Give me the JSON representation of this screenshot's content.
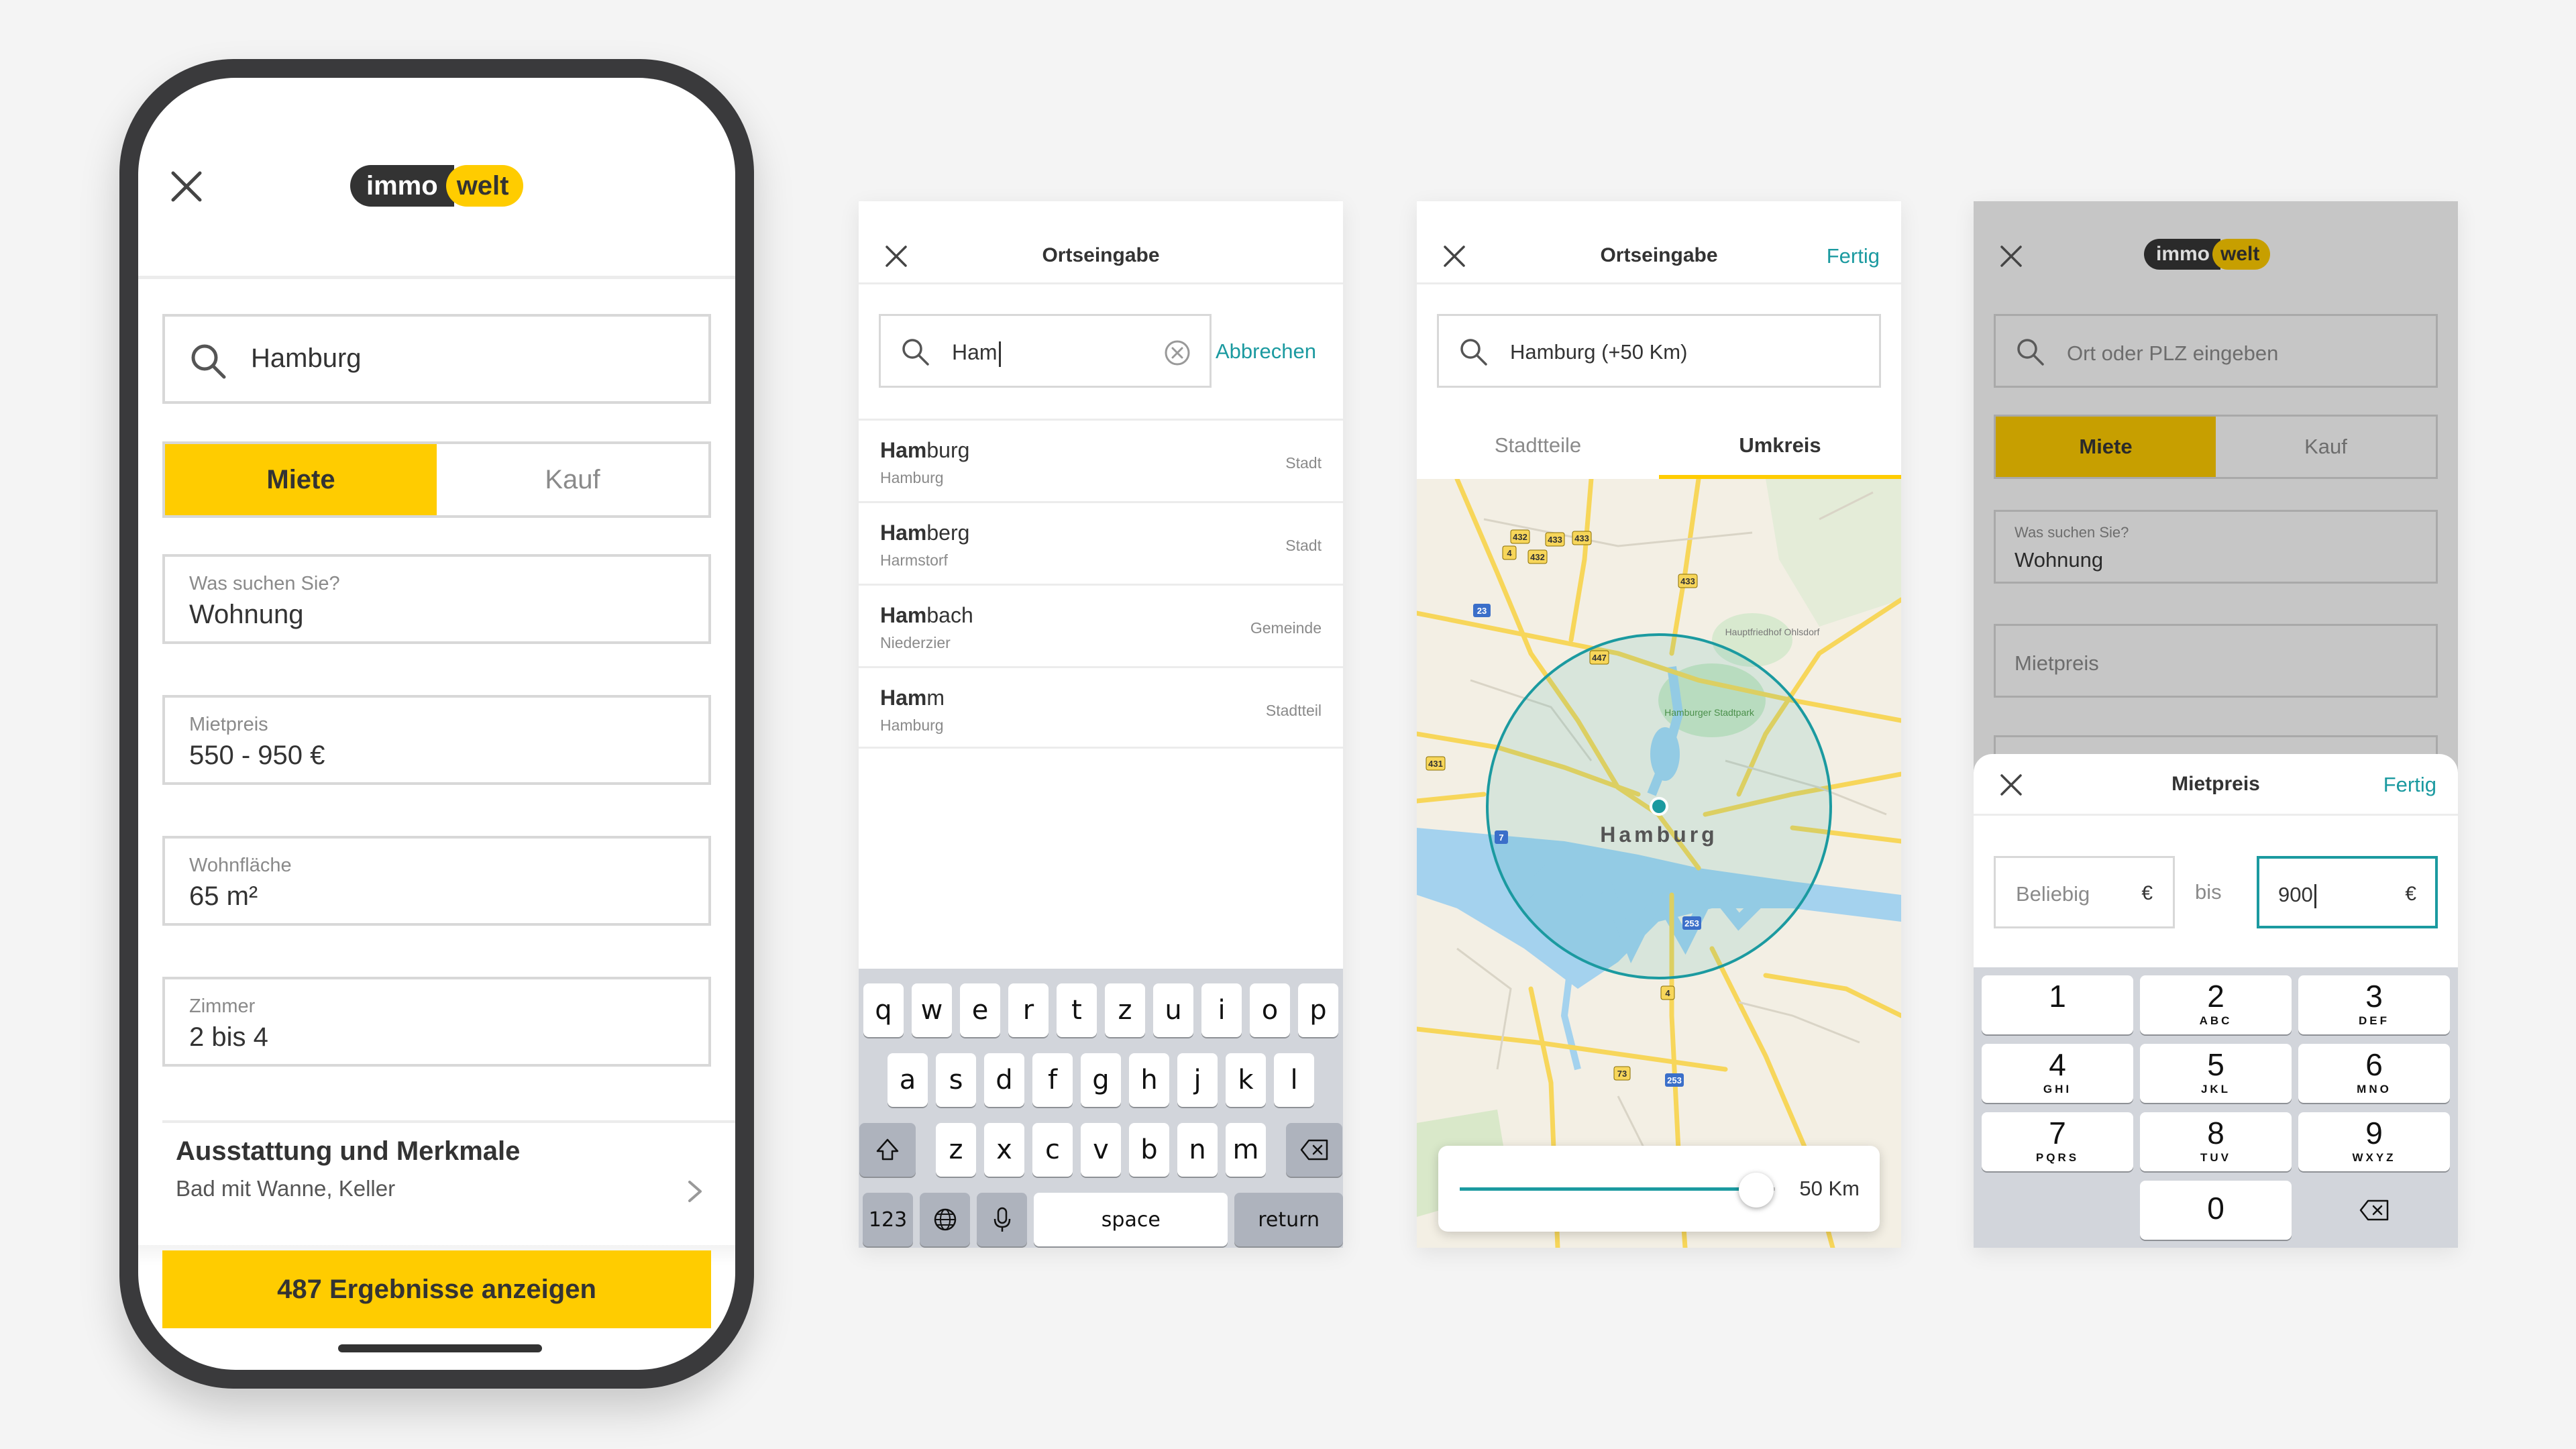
{
  "colors": {
    "accent_yellow": "#ffcc00",
    "teal": "#1b9aa0",
    "text_dark": "#333333",
    "text_grey": "#8a8a8a",
    "border": "#d8d8d8",
    "background": "#f4f4f4"
  },
  "logo": {
    "part1": "immo",
    "part2": "welt"
  },
  "screen1": {
    "search_value": "Hamburg",
    "segment": {
      "active": "Miete",
      "inactive": "Kauf"
    },
    "fields": [
      {
        "label": "Was suchen Sie?",
        "value": "Wohnung"
      },
      {
        "label": "Mietpreis",
        "value": "550 - 950 €"
      },
      {
        "label": "Wohnfläche",
        "value": "65 m²"
      },
      {
        "label": "Zimmer",
        "value": "2 bis 4"
      }
    ],
    "features": {
      "title": "Ausstattung und Merkmale",
      "subtitle": "Bad mit Wanne, Keller"
    },
    "cta": "487 Ergebnisse anzeigen",
    "icons": {
      "close": "close-icon",
      "search": "search-icon",
      "chevron": "chevron-right-icon"
    }
  },
  "screen2": {
    "title": "Ortseingabe",
    "search_value": "Ham",
    "cancel_label": "Abbrechen",
    "results": [
      {
        "match": "Ham",
        "rest": "burg",
        "sub": "Hamburg",
        "type": "Stadt"
      },
      {
        "match": "Ham",
        "rest": "berg",
        "sub": "Harmstorf",
        "type": "Stadt"
      },
      {
        "match": "Ham",
        "rest": "bach",
        "sub": "Niederzier",
        "type": "Gemeinde"
      },
      {
        "match": "Ham",
        "rest": "m",
        "sub": "Hamburg",
        "type": "Stadtteil"
      }
    ],
    "keyboard": {
      "row1": [
        "q",
        "w",
        "e",
        "r",
        "t",
        "z",
        "u",
        "i",
        "o",
        "p"
      ],
      "row2": [
        "a",
        "s",
        "d",
        "f",
        "g",
        "h",
        "j",
        "k",
        "l"
      ],
      "row3": [
        "z",
        "x",
        "c",
        "v",
        "b",
        "n",
        "m"
      ],
      "numbers": "123",
      "space": "space",
      "return": "return"
    }
  },
  "screen3": {
    "title": "Ortseingabe",
    "done_label": "Fertig",
    "search_value": "Hamburg (+50 Km)",
    "tabs": [
      "Stadtteile",
      "Umkreis"
    ],
    "active_tab": "Umkreis",
    "map": {
      "city": "Hamburg",
      "labels": {
        "stadtpark": "Hamburger Stadtpark",
        "friedhof": "Hauptfriedhof Ohlsdorf"
      },
      "road_numbers": [
        "432",
        "433",
        "433",
        "4",
        "433",
        "432",
        "23",
        "447",
        "7",
        "431",
        "253",
        "4",
        "73",
        "253"
      ]
    },
    "radius": {
      "value": "50 Km",
      "fraction": 0.94
    }
  },
  "screen4": {
    "search_placeholder": "Ort oder PLZ eingeben",
    "segment": {
      "active": "Miete",
      "inactive": "Kauf"
    },
    "field_label": "Was suchen Sie?",
    "field_value": "Wohnung",
    "price_label": "Mietpreis",
    "sheet": {
      "title": "Mietpreis",
      "done_label": "Fertig",
      "min_placeholder": "Beliebig",
      "currency": "€",
      "between": "bis",
      "max_value": "900"
    },
    "numpad": [
      {
        "n": "1",
        "a": ""
      },
      {
        "n": "2",
        "a": "ABC"
      },
      {
        "n": "3",
        "a": "DEF"
      },
      {
        "n": "4",
        "a": "GHI"
      },
      {
        "n": "5",
        "a": "JKL"
      },
      {
        "n": "6",
        "a": "MNO"
      },
      {
        "n": "7",
        "a": "PQRS"
      },
      {
        "n": "8",
        "a": "TUV"
      },
      {
        "n": "9",
        "a": "WXYZ"
      },
      {
        "n": "0",
        "a": ""
      }
    ]
  }
}
